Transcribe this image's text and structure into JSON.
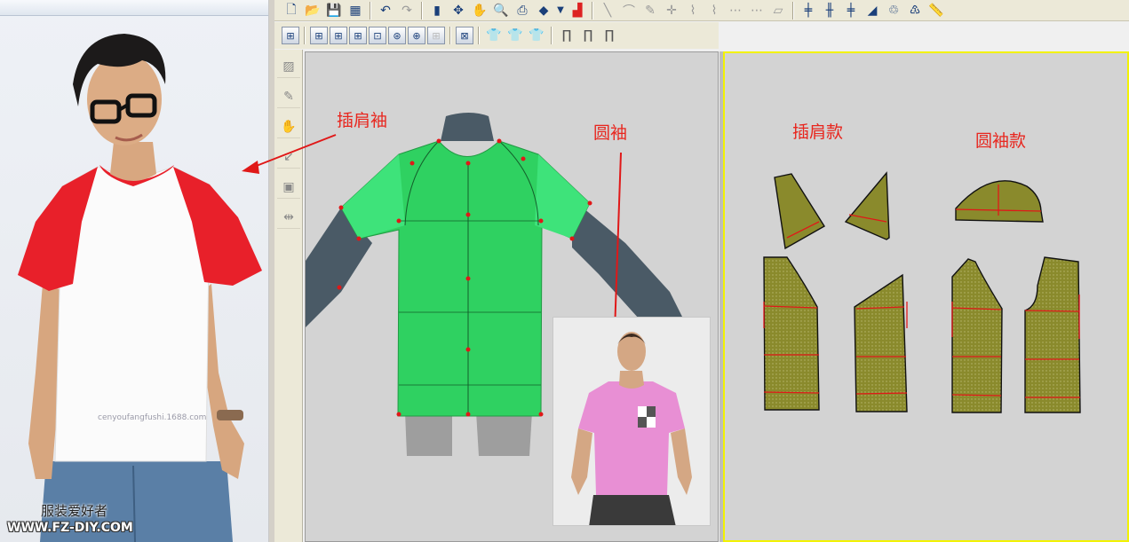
{
  "left_photo": {
    "watermark_site_cn": "服装爱好者",
    "watermark_url": "WWW.FZ-DIY.COM",
    "watermark_shop": "cenyoufangfushi.1688.com"
  },
  "toolbar_top": {
    "icons": [
      "new-file-icon",
      "open-folder-icon",
      "save-icon",
      "save-as-icon",
      "undo-icon",
      "redo-icon",
      "select-icon",
      "move-icon",
      "hand-icon",
      "zoom-doc-icon",
      "print-icon",
      "shield-icon",
      "dropdown-icon",
      "palette-icon",
      "line-icon",
      "curve-icon",
      "pen-icon",
      "point-icon",
      "arc-icon",
      "arc2-icon",
      "seam-icon",
      "seam2-icon",
      "eraser-icon",
      "ruler-v-icon",
      "ruler-v2-icon",
      "ruler-v3-icon",
      "grading-icon",
      "recycle-icon",
      "recycle2-icon",
      "measure-icon"
    ]
  },
  "toolbar_second": {
    "icons": [
      "grid-1-icon",
      "grid-2-icon",
      "grid-3-icon",
      "grid-4-icon",
      "grid-5-icon",
      "grid-6-icon",
      "grid-7-icon",
      "grid-8-icon",
      "grid-9-icon",
      "shirt-outline-icon",
      "shirt-outline-2-icon",
      "shirt-blue-icon",
      "pants-1-icon",
      "pants-2-icon",
      "pants-3-icon"
    ]
  },
  "vertical_tools": [
    "layer-icon",
    "pen-icon",
    "hand-icon",
    "arrow-icon",
    "box-icon",
    "split-icon"
  ],
  "annotations": {
    "raglan_sleeve": "插肩袖",
    "round_sleeve": "圆袖",
    "raglan_style": "插肩款",
    "round_style": "圆袖款"
  },
  "colors": {
    "annotation": "#e8261e",
    "garment_green": "#2fd161",
    "pattern_olive": "#8a8a2c",
    "active_border": "#f2f200",
    "tshirt_pink": "#e88fd4",
    "tshirt_red": "#e8202a"
  }
}
